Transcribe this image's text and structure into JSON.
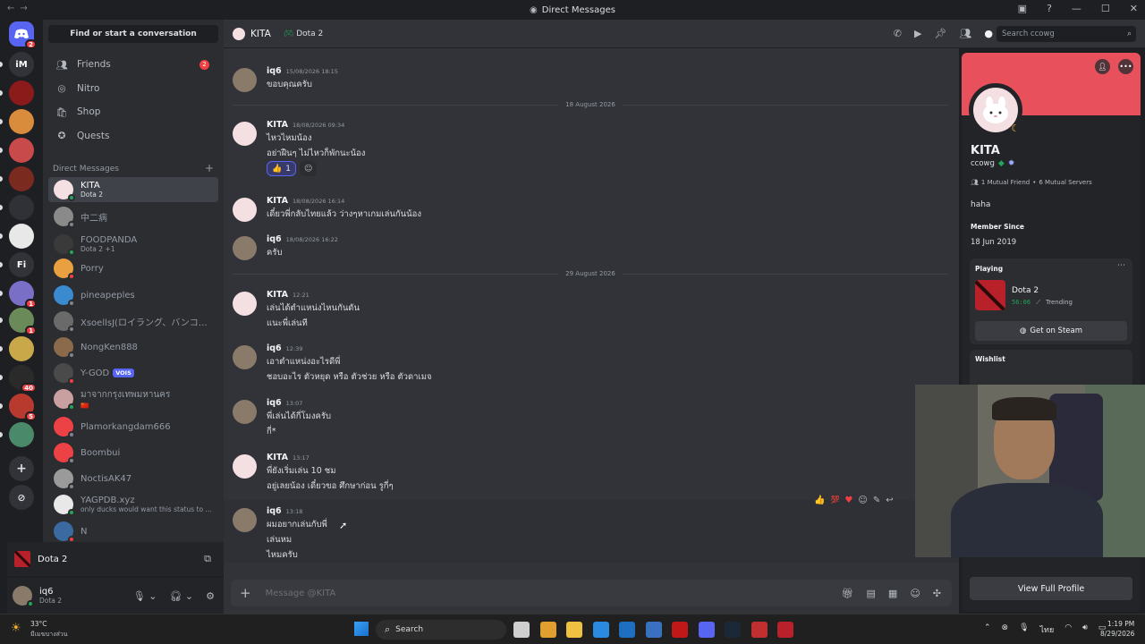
{
  "window": {
    "title": "Direct Messages"
  },
  "rail": {
    "servers": [
      {
        "label": "iM",
        "badge": "",
        "color": "#313338"
      },
      {
        "label": "",
        "badge": "",
        "color": "#8b1a1a"
      },
      {
        "label": "",
        "badge": "",
        "color": "#d98c3b"
      },
      {
        "label": "",
        "badge": "",
        "color": "#c94a4a"
      },
      {
        "label": "",
        "badge": "",
        "color": "#7a2a1f"
      },
      {
        "label": "",
        "badge": "",
        "color": "#2f3136"
      },
      {
        "label": "",
        "badge": "",
        "color": "#e8e8e8"
      },
      {
        "label": "Fi",
        "badge": "",
        "color": "#313338"
      },
      {
        "label": "",
        "badge": "1",
        "color": "#7a6fc7"
      },
      {
        "label": "",
        "badge": "1",
        "color": "#6b8a5a"
      },
      {
        "label": "",
        "badge": "",
        "color": "#c9a84a"
      },
      {
        "label": "",
        "badge": "40",
        "color": "#2a2a2a"
      },
      {
        "label": "",
        "badge": "5",
        "color": "#b83a2f"
      },
      {
        "label": "",
        "badge": "",
        "color": "#4a8a6a"
      }
    ],
    "home_badge": "2"
  },
  "sidebar": {
    "find_placeholder": "Find or start a conversation",
    "nav": [
      {
        "label": "Friends",
        "badge": "2",
        "icon": "friends-icon"
      },
      {
        "label": "Nitro",
        "badge": "",
        "icon": "nitro-icon"
      },
      {
        "label": "Shop",
        "badge": "",
        "icon": "shop-icon"
      },
      {
        "label": "Quests",
        "badge": "",
        "icon": "quests-icon"
      }
    ],
    "dm_header": "Direct Messages",
    "dms": [
      {
        "name": "KITA",
        "sub": "Dota 2",
        "color": "#f4dfe3",
        "status": "#23a55a",
        "active": true,
        "badge": ""
      },
      {
        "name": "中二病",
        "sub": "",
        "color": "#8a8a8a",
        "status": "#80848e",
        "active": false,
        "badge": ""
      },
      {
        "name": "FOODPANDA",
        "sub": "Dota 2 +1",
        "color": "#3a3a3a",
        "status": "#23a55a",
        "active": false,
        "badge": ""
      },
      {
        "name": "Porry",
        "sub": "",
        "color": "#e8a040",
        "status": "#f23f43",
        "active": false,
        "badge": ""
      },
      {
        "name": "pineapeples",
        "sub": "",
        "color": "#3a8ad0",
        "status": "#80848e",
        "active": false,
        "badge": ""
      },
      {
        "name": "XsoellsJ(ロイラング、バンコ…",
        "sub": "",
        "color": "#6a6a6a",
        "status": "#80848e",
        "active": false,
        "badge": ""
      },
      {
        "name": "NongKen888",
        "sub": "",
        "color": "#8a6a4a",
        "status": "#80848e",
        "active": false,
        "badge": ""
      },
      {
        "name": "Y-GOD",
        "sub": "",
        "color": "#4a4a4a",
        "status": "#f23f43",
        "active": false,
        "badge": "VOIS"
      },
      {
        "name": "มาจากกรุงเทพมหานคร",
        "sub": "🇨🇳",
        "color": "#c9a0a0",
        "status": "#23a55a",
        "active": false,
        "badge": ""
      },
      {
        "name": "Plamorkangdam666",
        "sub": "",
        "color": "#ed4245",
        "status": "#80848e",
        "active": false,
        "badge": ""
      },
      {
        "name": "Boombui",
        "sub": "",
        "color": "#ed4245",
        "status": "#80848e",
        "active": false,
        "badge": ""
      },
      {
        "name": "NoctisAK47",
        "sub": "",
        "color": "#9a9a9a",
        "status": "#80848e",
        "active": false,
        "badge": ""
      },
      {
        "name": "YAGPDB.xyz",
        "sub": "only ducks would want this status to be ce…",
        "color": "#e8e8e8",
        "status": "#23a55a",
        "active": false,
        "badge": ""
      },
      {
        "name": "N",
        "sub": "",
        "color": "#3a6aa0",
        "status": "#f23f43",
        "active": false,
        "badge": ""
      }
    ],
    "game": {
      "name": "Dota 2"
    },
    "user": {
      "name": "iq6",
      "sub": "Dota 2"
    }
  },
  "chat": {
    "recipient": "KITA",
    "game": "Dota 2",
    "search_placeholder": "Search ccowg",
    "composer_placeholder": "Message @KITA",
    "dates": [
      "18 August 2026",
      "29 August 2026"
    ],
    "messages": [
      {
        "author": "iq6",
        "time": "15/08/2026 18:15",
        "lines": [
          "ขอบคุณครับ"
        ],
        "kind": "iq6"
      },
      {
        "author": "KITA",
        "time": "18/08/2026 09:34",
        "lines": [
          "ไหวไหมน้อง",
          "อย่าฝืนๆ ไม่ไหวก็พักนะน้อง"
        ],
        "kind": "kita"
      },
      {
        "author": "KITA",
        "time": "18/08/2026 16:14",
        "lines": [
          "เดี๋ยวพี่กลับไทยแล้ว ว่างๆหาเกมเล่นกันน้อง"
        ],
        "kind": "kita"
      },
      {
        "author": "iq6",
        "time": "18/08/2026 16:22",
        "lines": [
          "ครับ"
        ],
        "kind": "iq6"
      },
      {
        "author": "KITA",
        "time": "12:21",
        "lines": [
          "เล่นได้ตำแหน่งไหนกันดัน",
          "แนะพี่เล่นที"
        ],
        "kind": "kita"
      },
      {
        "author": "iq6",
        "time": "12:39",
        "lines": [
          "เอาตำแหน่งอะไรดีพี่",
          "ชอบอะไร ตัวหยุด หรือ ตัวช่วย หรือ ตัวดาเมจ"
        ],
        "kind": "iq6"
      },
      {
        "author": "iq6",
        "time": "13:07",
        "lines": [
          "พี่เล่นได้กี่โมงครับ",
          "กี่*"
        ],
        "kind": "iq6"
      },
      {
        "author": "KITA",
        "time": "13:17",
        "lines": [
          "พี่ยังเริ่มเล่น 10 ชม",
          "อยู่เลยน้อง เดี๋ยวขอ ศึกษาก่อน รูกี่ๆ"
        ],
        "kind": "kita"
      },
      {
        "author": "iq6",
        "time": "13:18",
        "lines": [
          "ผมอยากเล่นกับพี่",
          "เล่นหม",
          "ไหมครับ"
        ],
        "kind": "iq6"
      }
    ],
    "reaction": {
      "emoji": "👍",
      "count": "1"
    }
  },
  "profile": {
    "name": "KITA",
    "username": "ccowg",
    "mutual_friends": "1 Mutual Friend",
    "mutual_servers": "6 Mutual Servers",
    "bio": "haha",
    "member_since_label": "Member Since",
    "member_since": "18 Jun 2019",
    "playing_label": "Playing",
    "game": "Dota 2",
    "elapsed": "56:06",
    "trending": "Trending",
    "steam_button": "Get on Steam",
    "wishlist_label": "Wishlist",
    "full_profile_button": "View Full Profile"
  },
  "taskbar": {
    "weather_temp": "33°C",
    "weather_desc": "มีเมฆบางส่วน",
    "search": "Search",
    "time": "1:19 PM",
    "date": "8/29/2026",
    "lang": "ไทย"
  }
}
